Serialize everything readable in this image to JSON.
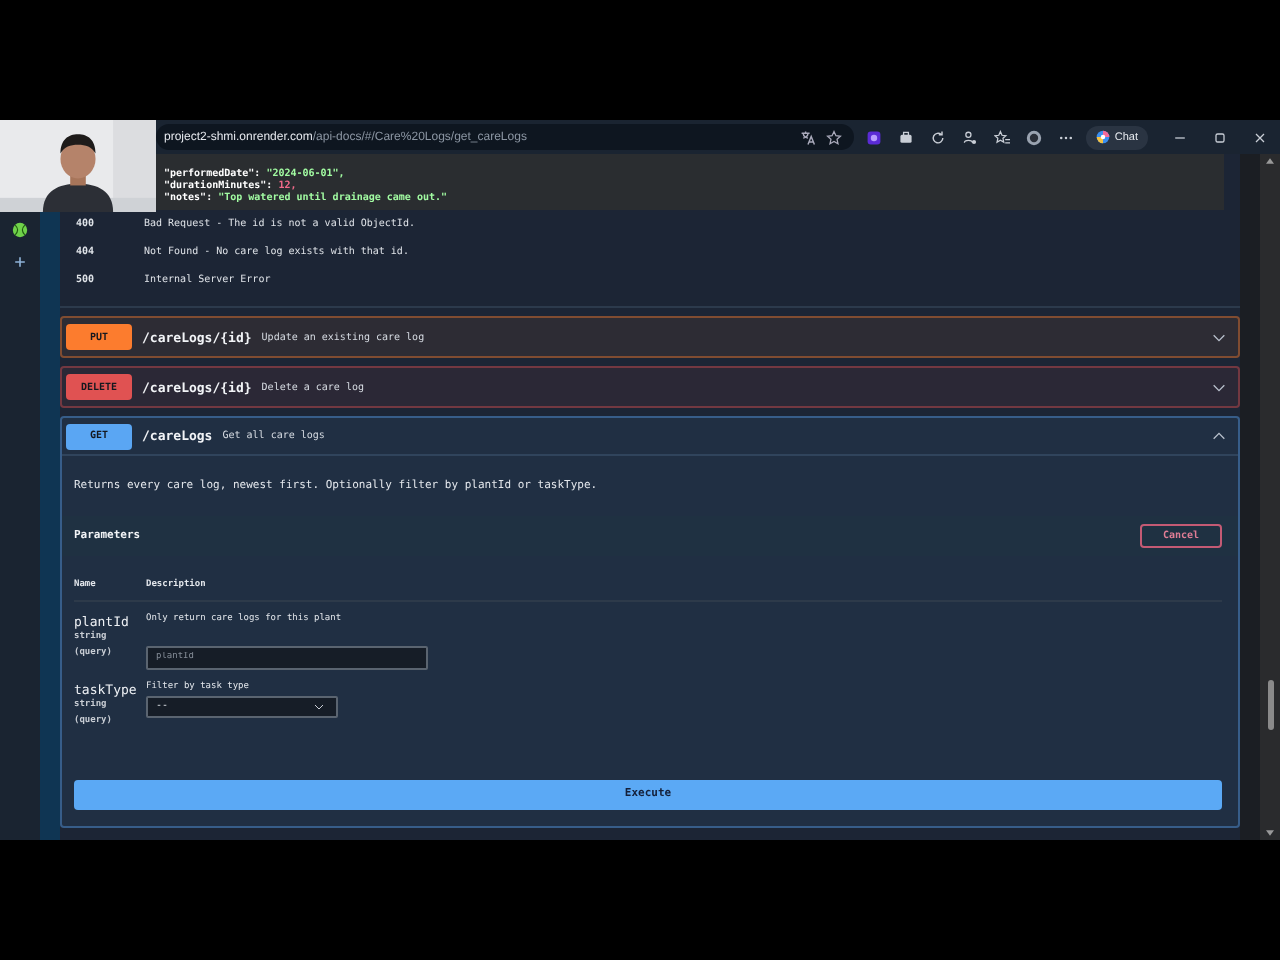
{
  "browser": {
    "url_domain": "project2-shmi.onrender.com",
    "url_path": "/api-docs/#/Care%20Logs/get_careLogs",
    "chat_label": "Chat"
  },
  "example_lines": [
    {
      "key": "\"performedDate\":",
      "value": "\"2024-06-01\",",
      "kind": "string"
    },
    {
      "key": "\"durationMinutes\":",
      "value": "12,",
      "kind": "number"
    },
    {
      "key": "\"notes\":",
      "value": "\"Top watered until drainage came out.\"",
      "kind": "string"
    }
  ],
  "responses": [
    {
      "code": "400",
      "description": "Bad Request - The id is not a valid ObjectId."
    },
    {
      "code": "404",
      "description": "Not Found - No care log exists with that id."
    },
    {
      "code": "500",
      "description": "Internal Server Error"
    }
  ],
  "operations": [
    {
      "method": "PUT",
      "path": "/careLogs/{id}",
      "summary": "Update an existing care log",
      "color": "#fc7c2e",
      "expanded": false
    },
    {
      "method": "DELETE",
      "path": "/careLogs/{id}",
      "summary": "Delete a care log",
      "color": "#e05252",
      "expanded": false
    },
    {
      "method": "GET",
      "path": "/careLogs",
      "summary": "Get all care logs",
      "color": "#5aa6f3",
      "expanded": true,
      "description": "Returns every care log, newest first. Optionally filter by plantId or taskType.",
      "parameters_title": "Parameters",
      "cancel_label": "Cancel",
      "columns": [
        "Name",
        "Description"
      ],
      "parameters": [
        {
          "name": "plantId",
          "type": "string",
          "location": "(query)",
          "description": "Only return care logs for this plant",
          "kind": "input",
          "placeholder": "plantId"
        },
        {
          "name": "taskType",
          "type": "string",
          "location": "(query)",
          "description": "Filter by task type",
          "kind": "select",
          "value": "--"
        }
      ],
      "execute_label": "Execute"
    }
  ]
}
